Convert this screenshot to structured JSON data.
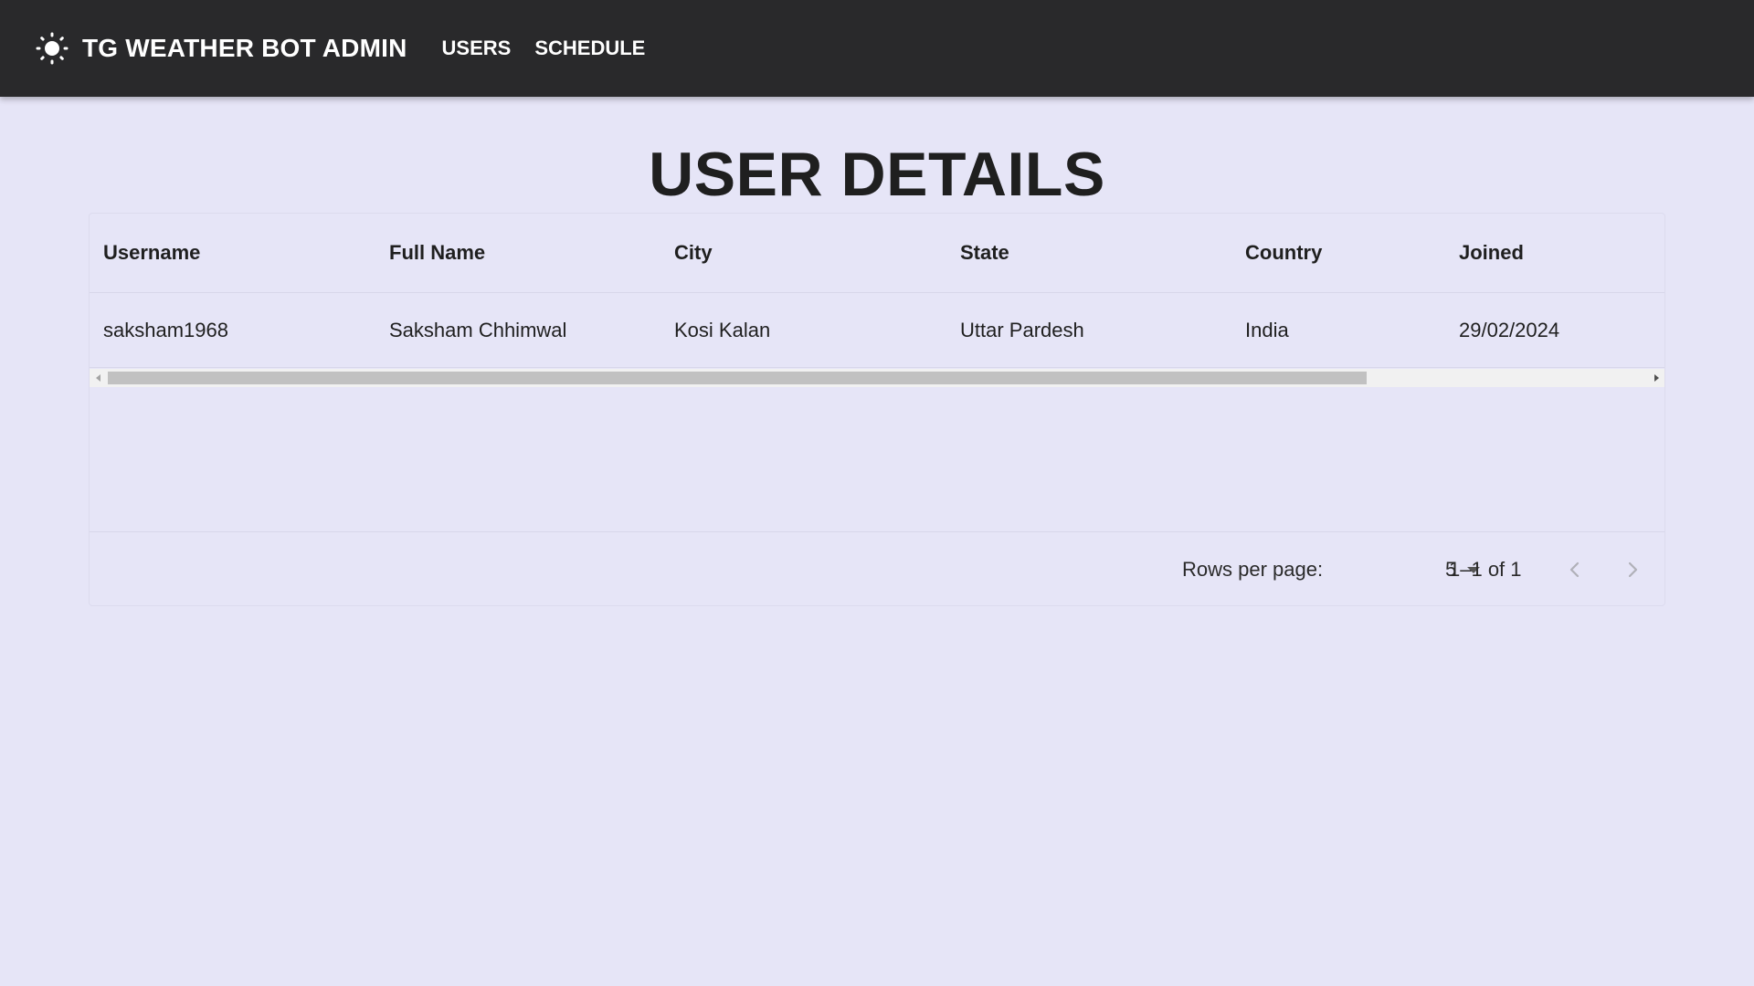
{
  "appbar": {
    "icon": "sun-icon",
    "title": "TG WEATHER BOT ADMIN",
    "nav": [
      "USERS",
      "SCHEDULE"
    ],
    "background": "#29292b"
  },
  "page": {
    "title": "USER DETAILS",
    "background": "#e6e5f7"
  },
  "table": {
    "columns": [
      "Username",
      "Full Name",
      "City",
      "State",
      "Country",
      "Joined"
    ],
    "rows": [
      [
        "saksham1968",
        "Saksham Chhimwal",
        "Kosi Kalan",
        "Uttar Pardesh",
        "India",
        "29/02/2024"
      ]
    ]
  },
  "pagination": {
    "rows_per_page_label": "Rows per page:",
    "rows_per_page_value": "5",
    "range": "1–1 of 1",
    "prev_icon": "chevron-left-icon",
    "next_icon": "chevron-right-icon"
  }
}
